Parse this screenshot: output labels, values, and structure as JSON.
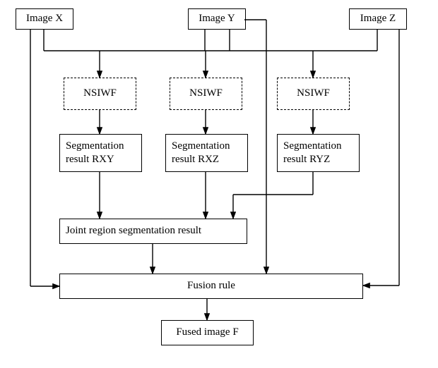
{
  "inputs": {
    "x": "Image X",
    "y": "Image Y",
    "z": "Image Z"
  },
  "nsiwf": {
    "a": "NSIWF",
    "b": "NSIWF",
    "c": "NSIWF"
  },
  "segmentation": {
    "rxy": "Segmentation result RXY",
    "rxz": "Segmentation result RXZ",
    "ryz": "Segmentation result RYZ"
  },
  "joint": "Joint region segmentation result",
  "fusion_rule": "Fusion rule",
  "fused": "Fused image F"
}
